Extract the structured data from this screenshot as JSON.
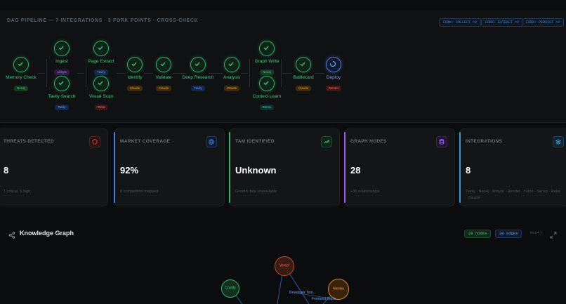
{
  "pipeline": {
    "title": "DAG PIPELINE — 7 INTEGRATIONS · 3 FORK POINTS · CROSS-CHECK",
    "forks": [
      "FORK: COLLECT ×2",
      "FORK: EXTRACT ×2",
      "FORK: PERSIST ×2"
    ],
    "nodes": [
      {
        "label": "Memory Check",
        "tag": "Neo4j"
      },
      {
        "label": "Ingest",
        "tag": "Airbyte"
      },
      {
        "label": "Tavily Search",
        "tag": "Tavily"
      },
      {
        "label": "Page Extract",
        "tag": "Tavily"
      },
      {
        "label": "Visual Scan",
        "tag": "Reka"
      },
      {
        "label": "Identify",
        "tag": "Claude"
      },
      {
        "label": "Validate",
        "tag": "Claude"
      },
      {
        "label": "Deep Research",
        "tag": "Tavily"
      },
      {
        "label": "Analysis",
        "tag": "Claude"
      },
      {
        "label": "Graph Write",
        "tag": "Neo4j"
      },
      {
        "label": "Context Learn",
        "tag": "Senso"
      },
      {
        "label": "Battlecard",
        "tag": "Claude"
      },
      {
        "label": "Deploy",
        "tag": "Render"
      }
    ]
  },
  "cards": [
    {
      "title": "THREATS DETECTED",
      "value": "8",
      "sub": "1 critical, 5 high",
      "icon": "shield-icon",
      "color": "#e04848"
    },
    {
      "title": "MARKET COVERAGE",
      "value": "92%",
      "sub": "8 competitors mapped",
      "icon": "target-icon",
      "color": "#4b7fe0"
    },
    {
      "title": "TAM IDENTIFIED",
      "value": "Unknown",
      "sub": "Growth data unavailable",
      "icon": "trending-up-icon",
      "color": "#2fb36b"
    },
    {
      "title": "GRAPH NODES",
      "value": "28",
      "sub": "+30 relationships",
      "icon": "database-icon",
      "color": "#a45cf0"
    },
    {
      "title": "INTEGRATIONS",
      "value": "8",
      "sub": "Tavily · Neo4j · Airbyte · Render · Yutori · Senso · Reka · Claude",
      "icon": "layers-icon",
      "color": "#2e9ad6"
    }
  ],
  "graph": {
    "title": "Knowledge Graph",
    "nodes_badge": "28 nodes",
    "edges_badge": "30 edges",
    "engine": "Neo4j",
    "node_labels": [
      "Vercel",
      "Coolify",
      "Heroku",
      "Developer Tool...",
      "Frontend Deplo..."
    ]
  }
}
